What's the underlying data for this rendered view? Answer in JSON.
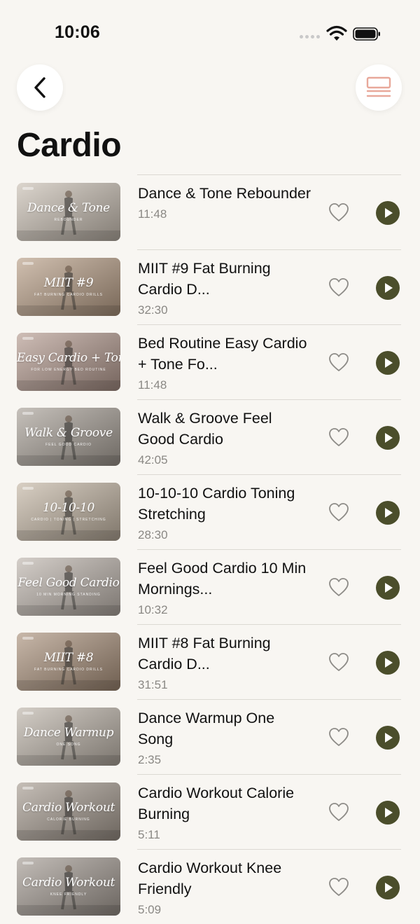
{
  "status_bar": {
    "time": "10:06"
  },
  "nav": {
    "back_icon": "chevron-left-icon",
    "list_icon": "list-view-icon"
  },
  "page": {
    "title": "Cardio"
  },
  "colors": {
    "accent": "#4b4e2b",
    "background": "#f8f6f2",
    "list_icon": "#e8a89a"
  },
  "workouts": [
    {
      "title": "Dance & Tone Rebounder",
      "duration": "11:48",
      "thumb_label": "Dance & Tone",
      "thumb_sub": "REBOUNDER",
      "bg": "#c9bfb3"
    },
    {
      "title": "MIIT #9 Fat Burning Cardio D...",
      "duration": "32:30",
      "thumb_label": "MIIT #9",
      "thumb_sub": "FAT BURNING CARDIO DRILLS",
      "bg": "#b89e86"
    },
    {
      "title": "Bed Routine Easy Cardio + Tone Fo...",
      "duration": "11:48",
      "thumb_label": "Easy Cardio + Tone",
      "thumb_sub": "FOR LOW ENERGY BED ROUTINE",
      "bg": "#b49a8f"
    },
    {
      "title": "Walk & Groove Feel Good Cardio",
      "duration": "42:05",
      "thumb_label": "Walk & Groove",
      "thumb_sub": "FEEL GOOD CARDIO",
      "bg": "#a8a097"
    },
    {
      "title": "10-10-10 Cardio Toning Stretching",
      "duration": "28:30",
      "thumb_label": "10-10-10",
      "thumb_sub": "CARDIO | TONING | STRETCHING",
      "bg": "#c4b6a4"
    },
    {
      "title": "Feel Good Cardio 10 Min Mornings...",
      "duration": "10:32",
      "thumb_label": "Feel Good Cardio",
      "thumb_sub": "10 MIN MORNING STANDING",
      "bg": "#beb5ad"
    },
    {
      "title": "MIIT #8 Fat Burning Cardio D...",
      "duration": "31:51",
      "thumb_label": "MIIT #8",
      "thumb_sub": "FAT BURNING CARDIO DRILLS",
      "bg": "#aa917b"
    },
    {
      "title": "Dance Warmup One Song",
      "duration": "2:35",
      "thumb_label": "Dance Warmup",
      "thumb_sub": "ONE SONG",
      "bg": "#bdb4a9"
    },
    {
      "title": "Cardio Workout Calorie Burning",
      "duration": "5:11",
      "thumb_label": "Cardio Workout",
      "thumb_sub": "CALORIE BURNING",
      "bg": "#a69b90"
    },
    {
      "title": "Cardio Workout Knee Friendly",
      "duration": "5:09",
      "thumb_label": "Cardio Workout",
      "thumb_sub": "KNEE FRIENDLY",
      "bg": "#a39a92"
    }
  ]
}
